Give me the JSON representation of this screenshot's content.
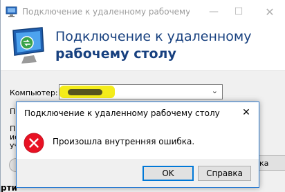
{
  "parent_window": {
    "title": "Подключение к удаленному рабочему с...",
    "heading_line1": "Подключение к удаленному",
    "heading_line2": "рабочему столу",
    "computer_label": "Компьютер:",
    "computer_value": "",
    "partial_label_1": "П",
    "partial_text_lines": [
      "Пр",
      "ис",
      "уч"
    ],
    "partial_button_right": "кa",
    "bottom_partial": "рти"
  },
  "error_dialog": {
    "title": "Подключение к удаленному рабочему столу",
    "message": "Произошла внутренняя ошибка.",
    "ok_label": "OK",
    "help_label": "Справка",
    "icon": "error-icon",
    "icon_color": "#e81123"
  },
  "colors": {
    "heading": "#17407f",
    "accent": "#0078d7",
    "highlight": "#f4ec1a"
  }
}
